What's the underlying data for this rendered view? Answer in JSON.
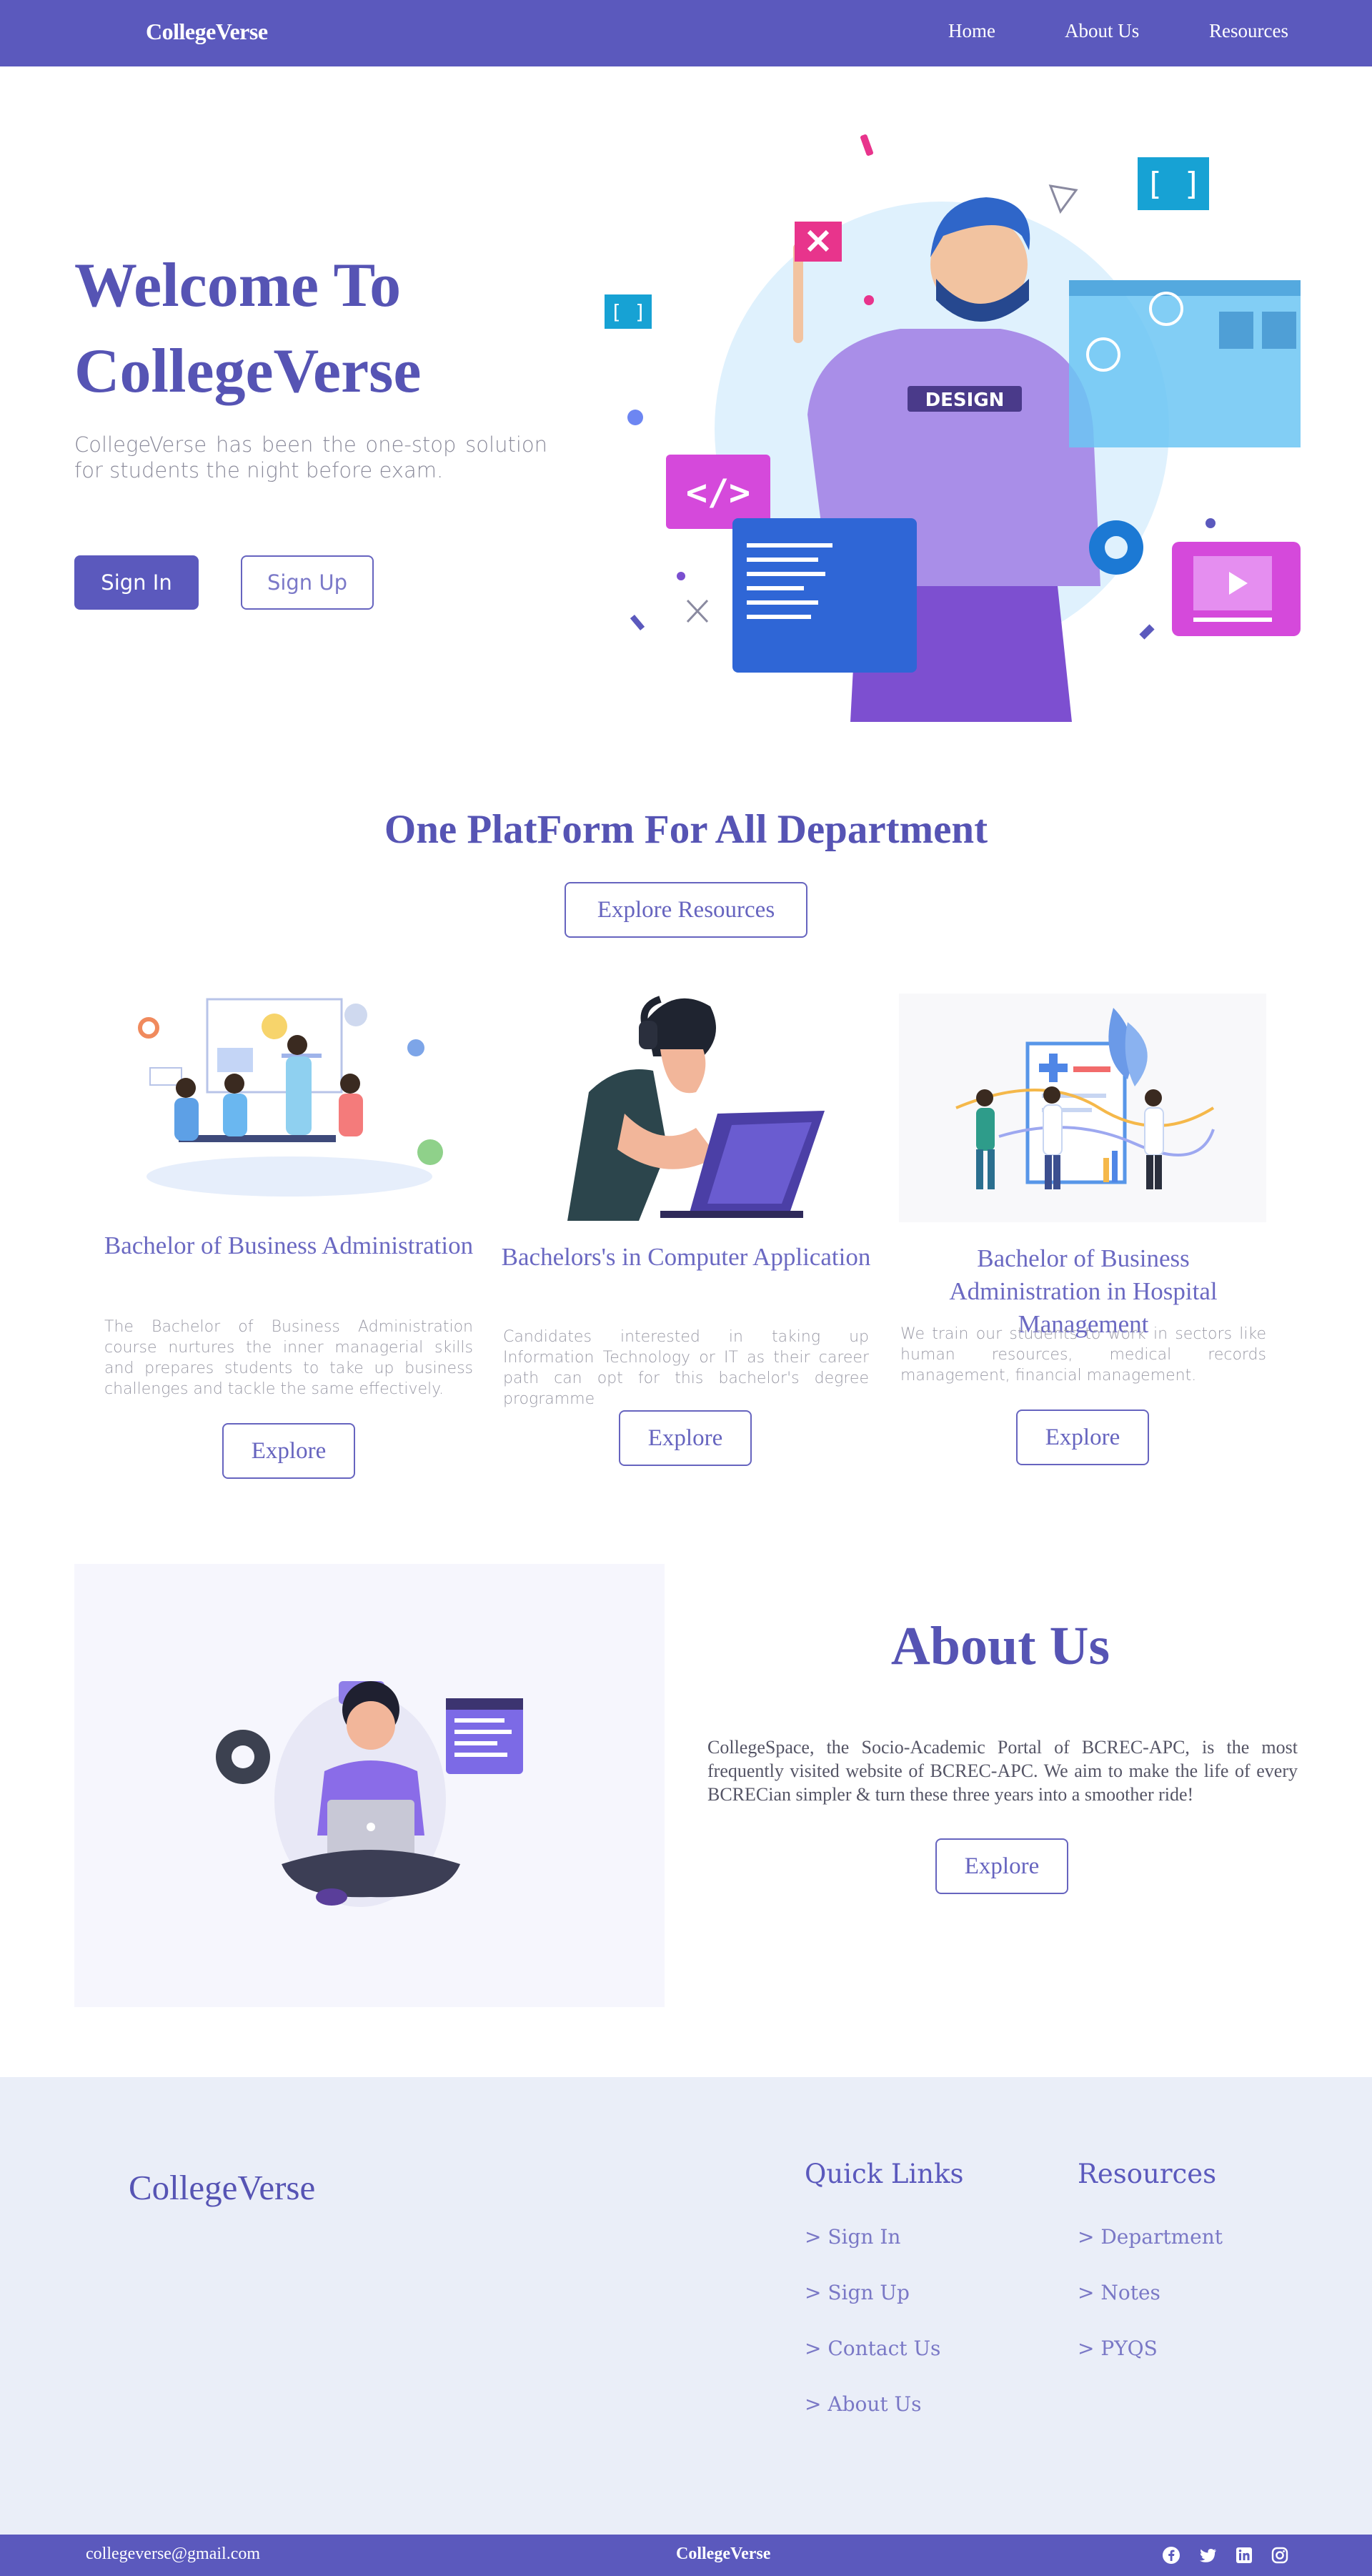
{
  "navbar": {
    "brand": "CollegeVerse",
    "links": [
      "Home",
      "About Us",
      "Resources"
    ]
  },
  "hero": {
    "title_line1": "Welcome To",
    "title_line2": "CollegeVerse",
    "description": "CollegeVerse has been the one-stop solution for students the night before exam.",
    "signin_label": "Sign In",
    "signup_label": "Sign Up",
    "illustration_badge": "DESIGN"
  },
  "platform": {
    "title": "One PlatForm For All Department",
    "explore_label": "Explore Resources",
    "cards": [
      {
        "title": "Bachelor of Business Administration",
        "description": "The Bachelor of Business Administration course nurtures the inner managerial skills and prepares students to take up business challenges and tackle the same effectively.",
        "button": "Explore"
      },
      {
        "title": "Bachelors's in Computer Application",
        "description": "Candidates interested in taking up Information Technology or IT as their career path can opt for this bachelor's degree programme",
        "button": "Explore"
      },
      {
        "title": "Bachelor of Business Administration in Hospital Management",
        "description": "We train our students to work in sectors like human resources, medical records management, financial management.",
        "button": "Explore"
      }
    ]
  },
  "about": {
    "title": "About Us",
    "description": "CollegeSpace, the Socio-Academic Portal of BCREC-APC, is the most frequently visited website of BCREC-APC. We aim to make the life of every BCRECian simpler & turn these three years into a smoother ride!",
    "button": "Explore"
  },
  "footer": {
    "brand": "CollegeVerse",
    "quick_links_title": "Quick Links",
    "quick_links": [
      "> Sign In",
      "> Sign Up",
      "> Contact Us",
      "> About Us"
    ],
    "resources_title": "Resources",
    "resources": [
      "> Department",
      "> Notes",
      "> PYQS"
    ]
  },
  "bottombar": {
    "email": "collegeverse@gmail.com",
    "brand": "CollegeVerse",
    "social_icons": [
      "facebook-icon",
      "twitter-icon",
      "linkedin-icon",
      "instagram-icon"
    ]
  },
  "colors": {
    "primary": "#5b59bd",
    "footer_bg": "#eaeef8",
    "text_muted": "#8a8a9a"
  }
}
